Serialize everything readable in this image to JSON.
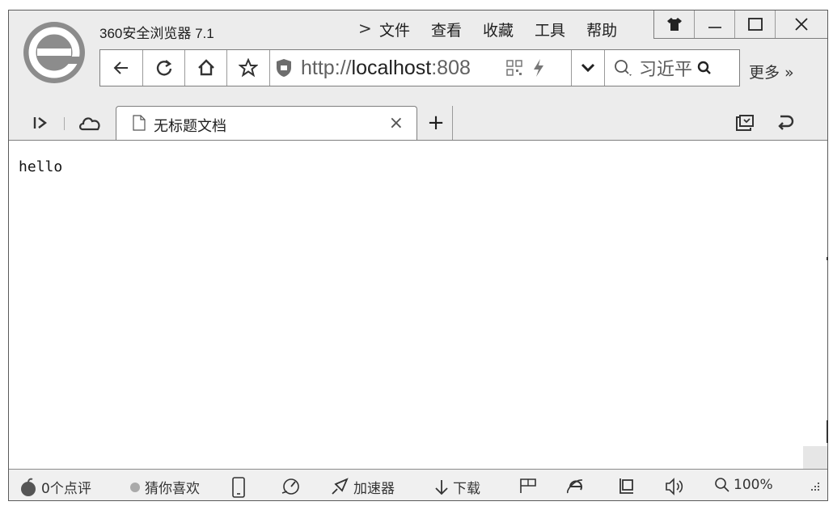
{
  "window": {
    "app_title": "360安全浏览器 7.1",
    "menu_arrow": ">",
    "menu": [
      "文件",
      "查看",
      "收藏",
      "工具",
      "帮助"
    ]
  },
  "toolbar": {
    "url_prefix": "http://",
    "url_host": "localhost",
    "url_suffix": ":808",
    "search_text": "习近平",
    "more_label": "更多 »"
  },
  "tabs": [
    {
      "title": "无标题文档",
      "close": "×"
    }
  ],
  "new_tab_label": "+",
  "page": {
    "text": "hello"
  },
  "status": {
    "comments": "0个点评",
    "guess": "猜你喜欢",
    "accelerator": "加速器",
    "download": "下载",
    "zoom": "100%"
  },
  "icons": [
    "browser-logo-icon",
    "shirt-icon",
    "minimize-icon",
    "maximize-icon",
    "close-icon",
    "back-icon",
    "refresh-icon",
    "home-icon",
    "star-icon",
    "shield-icon",
    "qr-code-icon",
    "lightning-icon",
    "chevron-down-icon",
    "search-icon",
    "sidebar-toggle-icon",
    "cloud-icon",
    "document-icon",
    "restore-tabs-icon",
    "undo-icon",
    "apple-icon",
    "phone-icon",
    "speed-icon",
    "rocket-icon",
    "download-icon",
    "flag-icon",
    "ie-icon",
    "window-icon",
    "volume-icon",
    "zoom-icon"
  ]
}
